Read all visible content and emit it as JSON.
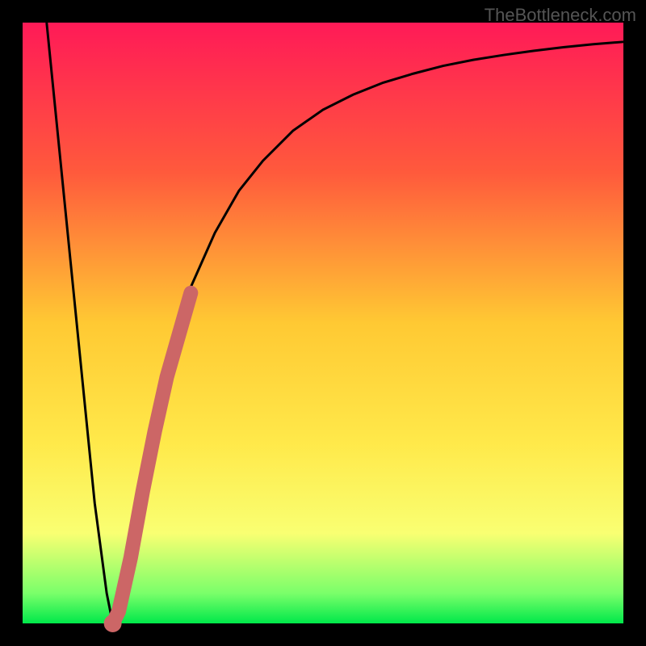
{
  "watermark": "TheBottleneck.com",
  "chart_data": {
    "type": "line",
    "title": "",
    "xlabel": "",
    "ylabel": "",
    "xlim": [
      0,
      100
    ],
    "ylim": [
      0,
      100
    ],
    "series": [
      {
        "name": "main-curve",
        "x": [
          4,
          6,
          8,
          10,
          12,
          14,
          15,
          16,
          18,
          20,
          22,
          25,
          28,
          32,
          36,
          40,
          45,
          50,
          55,
          60,
          65,
          70,
          75,
          80,
          85,
          90,
          95,
          100
        ],
        "values": [
          100,
          80,
          60,
          40,
          20,
          5,
          0,
          3,
          13,
          25,
          35,
          47,
          56,
          65,
          72,
          77,
          82,
          85.5,
          88,
          90,
          91.5,
          92.8,
          93.8,
          94.6,
          95.3,
          95.9,
          96.4,
          96.8
        ]
      },
      {
        "name": "highlight-segment",
        "x": [
          15,
          16,
          18,
          20,
          22,
          24,
          26,
          28
        ],
        "values": [
          0,
          2,
          11,
          22,
          32,
          41,
          48,
          55
        ]
      }
    ],
    "gradient_stops": [
      {
        "offset": 0,
        "color": "#ff1a57"
      },
      {
        "offset": 25,
        "color": "#ff5a3c"
      },
      {
        "offset": 50,
        "color": "#ffc933"
      },
      {
        "offset": 70,
        "color": "#ffe94a"
      },
      {
        "offset": 85,
        "color": "#f9ff72"
      },
      {
        "offset": 95,
        "color": "#7aff6a"
      },
      {
        "offset": 100,
        "color": "#00e84a"
      }
    ],
    "frame_color": "#000000",
    "frame_width": 28
  }
}
